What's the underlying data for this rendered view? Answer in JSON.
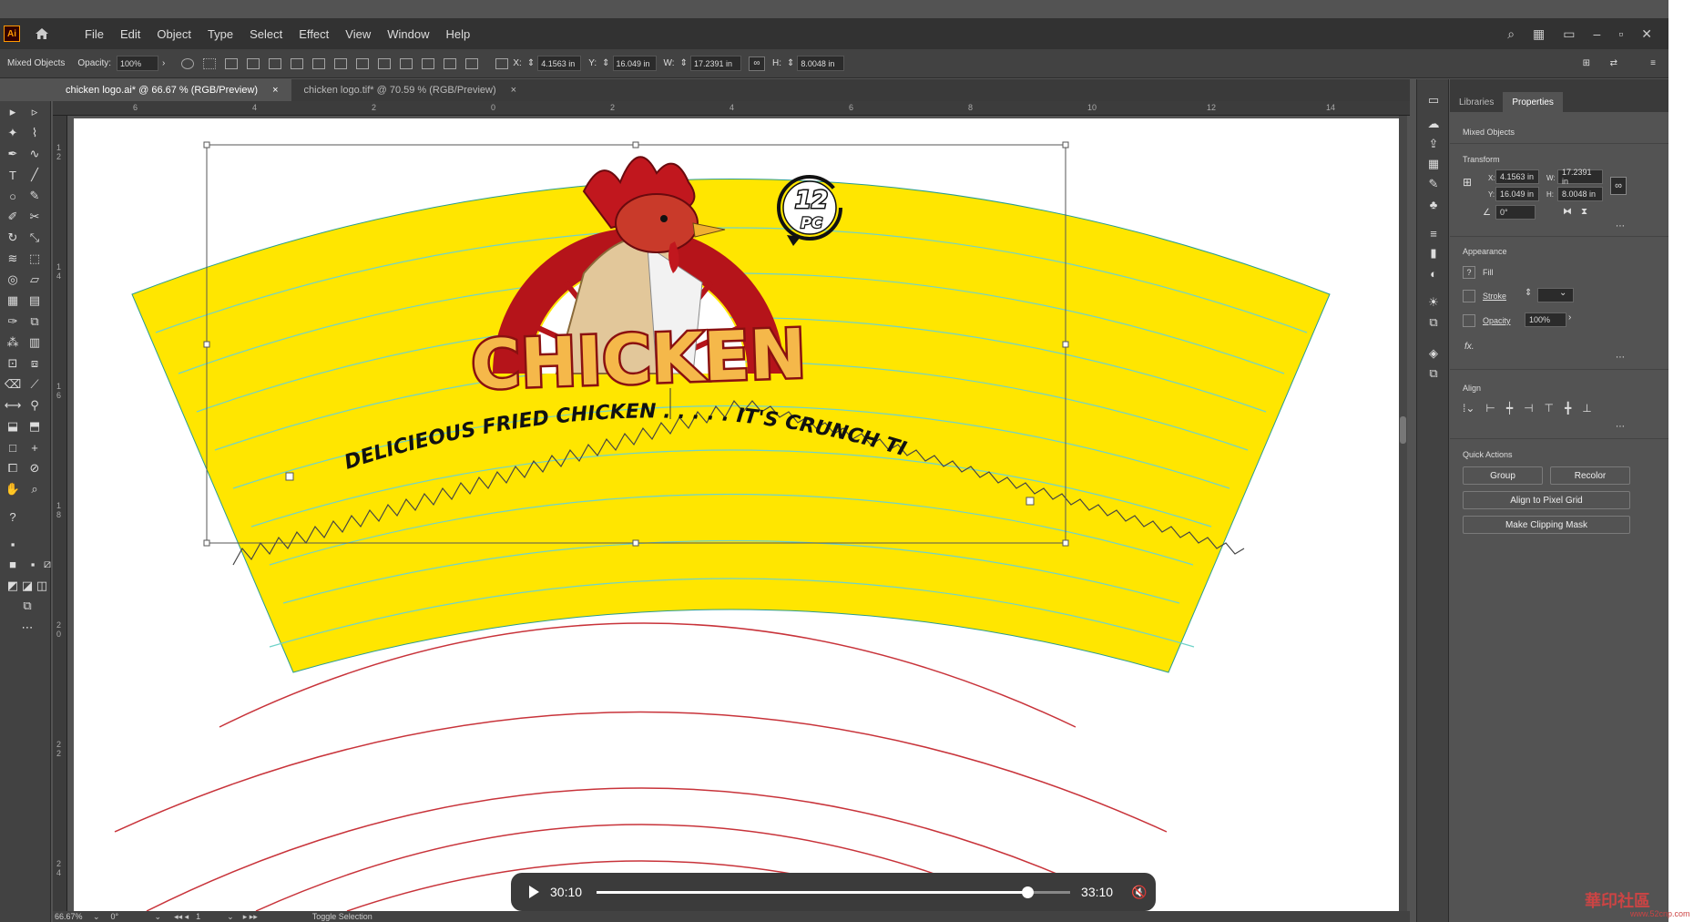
{
  "app": {
    "logo": "Ai",
    "menus": [
      "File",
      "Edit",
      "Object",
      "Type",
      "Select",
      "Effect",
      "View",
      "Window",
      "Help"
    ]
  },
  "control_bar": {
    "selection": "Mixed Objects",
    "opacity_label": "Opacity:",
    "opacity_value": "100%",
    "x_label": "X:",
    "x_value": "4.1563 in",
    "y_label": "Y:",
    "y_value": "16.049 in",
    "w_label": "W:",
    "w_value": "17.2391 in",
    "h_label": "H:",
    "h_value": "8.0048 in"
  },
  "tabs": [
    {
      "label": "chicken logo.ai* @ 66.67 % (RGB/Preview)",
      "close": "×"
    },
    {
      "label": "chicken logo.tif* @ 70.59 % (RGB/Preview)",
      "close": "×"
    }
  ],
  "ruler_h": [
    "6",
    "4",
    "2",
    "0",
    "2",
    "4",
    "6",
    "8",
    "10",
    "12",
    "14"
  ],
  "ruler_v": [
    "1",
    "2",
    "1",
    "4",
    "1",
    "6",
    "1",
    "8",
    "2",
    "0",
    "2",
    "2",
    "2",
    "4"
  ],
  "artwork": {
    "brand": "CHICKEN",
    "badge_number": "12",
    "badge_unit": "PC",
    "tagline": "DELICIEOUS FRIED CHICKEN . . . . . IT'S CRUNCH TIME"
  },
  "colors": {
    "cup_fill": "#FFE600",
    "guide": "#6fd3c9",
    "cut_line": "#c8333a",
    "badge_red": "#b5141a"
  },
  "media": {
    "current": "30:10",
    "total": "33:10",
    "progress": 0.909
  },
  "status": {
    "zoom": "66.67%",
    "rotation": "0°",
    "artboard": "1",
    "toggle": "Toggle Selection"
  },
  "panel": {
    "tabs": [
      "Libraries",
      "Properties"
    ],
    "selection": "Mixed Objects",
    "transform_title": "Transform",
    "x_label": "X:",
    "x_value": "4.1563 in",
    "y_label": "Y:",
    "y_value": "16.049 in",
    "w_label": "W:",
    "w_value": "17.2391 in",
    "h_label": "H:",
    "h_value": "8.0048 in",
    "angle_value": "0°",
    "appearance_title": "Appearance",
    "fill_label": "Fill",
    "stroke_label": "Stroke",
    "opacity_label": "Opacity",
    "opacity_value": "100%",
    "fx_label": "fx.",
    "align_title": "Align",
    "quick_actions_title": "Quick Actions",
    "group_btn": "Group",
    "recolor_btn": "Recolor",
    "pixel_grid_btn": "Align to Pixel Grid",
    "clipping_btn": "Make Clipping Mask"
  },
  "watermark": {
    "text": "華印社區",
    "sub": "www.52cnp.com"
  }
}
